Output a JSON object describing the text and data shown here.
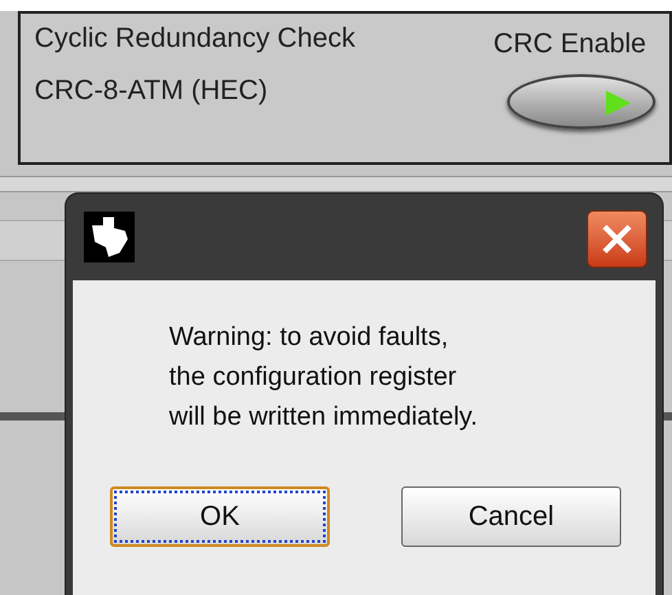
{
  "panel": {
    "title": "Cyclic Redundancy Check",
    "value": "CRC-8-ATM (HEC)",
    "toggle_label": "CRC Enable",
    "toggle_on": true
  },
  "dialog": {
    "message": "Warning: to avoid faults,\nthe configuration register\nwill be written immediately.",
    "buttons": [
      {
        "label": "OK",
        "default": true
      },
      {
        "label": "Cancel",
        "default": false
      }
    ]
  }
}
